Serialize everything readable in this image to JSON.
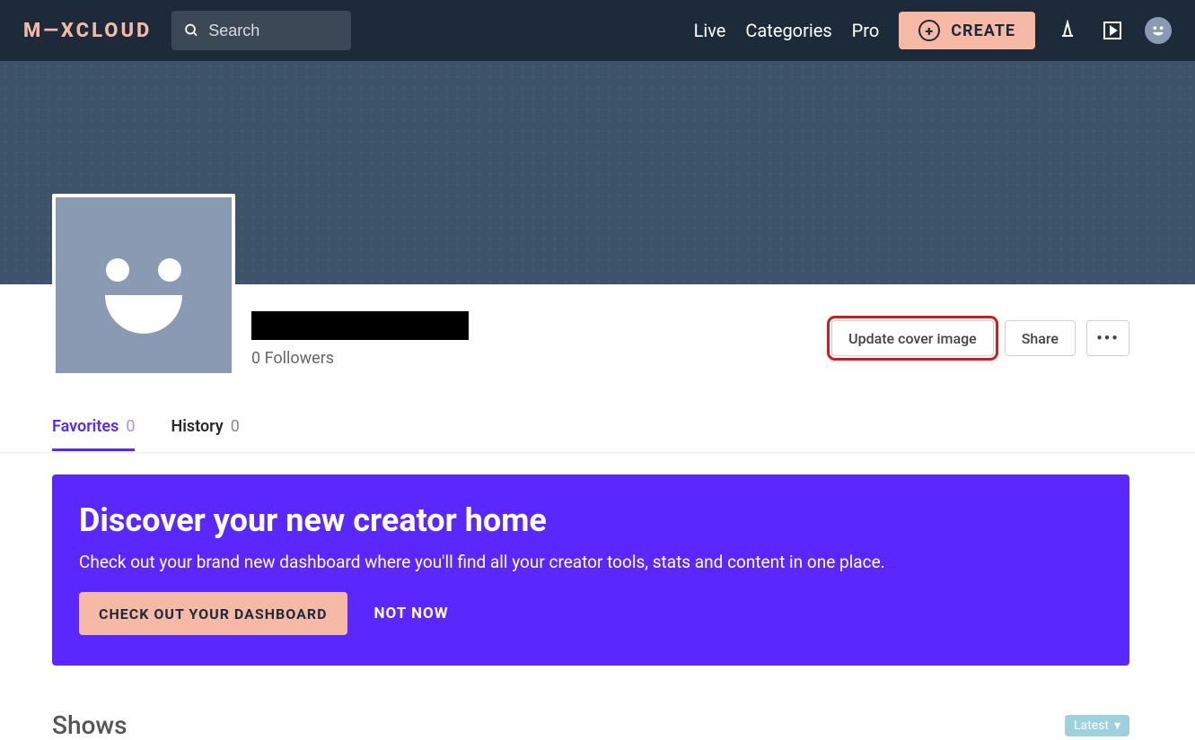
{
  "header": {
    "logo": "M—XCLOUD",
    "search_placeholder": "Search",
    "nav": {
      "live": "Live",
      "categories": "Categories",
      "pro": "Pro"
    },
    "create_label": "CREATE"
  },
  "profile": {
    "name_redacted": true,
    "followers_text": "0 Followers",
    "update_cover_label": "Update cover image",
    "share_label": "Share"
  },
  "tabs": {
    "favorites": {
      "label": "Favorites",
      "count": "0"
    },
    "history": {
      "label": "History",
      "count": "0"
    }
  },
  "banner": {
    "title": "Discover your new creator home",
    "body": "Check out your brand new dashboard where you'll find all your creator tools, stats and content in one place.",
    "cta": "CHECK OUT YOUR DASHBOARD",
    "dismiss": "NOT NOW"
  },
  "shows": {
    "heading": "Shows",
    "sort_label": "Latest"
  }
}
